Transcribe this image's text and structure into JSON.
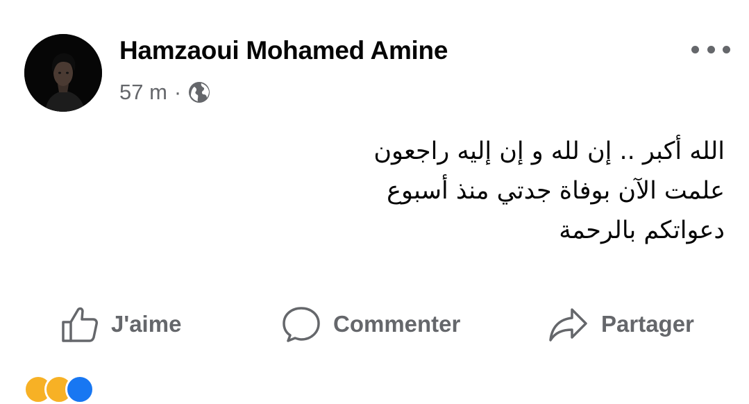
{
  "post": {
    "author": "Hamzaoui Mohamed Amine",
    "time": "57 m",
    "separator": "·",
    "privacy_icon": "globe-icon",
    "more_icon": "more-horizontal-icon",
    "text_lines": [
      "الله أكبر .. إن لله و إن إليه راجعون",
      "علمت الآن بوفاة جدتي منذ أسبوع",
      "دعواتكم بالرحمة"
    ]
  },
  "actions": {
    "like": {
      "label": "J'aime",
      "icon": "thumbs-up-icon"
    },
    "comment": {
      "label": "Commenter",
      "icon": "comment-bubble-icon"
    },
    "share": {
      "label": "Partager",
      "icon": "share-arrow-icon"
    }
  },
  "reactions": [
    {
      "icon": "haha-reaction-icon",
      "color": "#f7b125"
    },
    {
      "icon": "sad-reaction-icon",
      "color": "#f7b125"
    },
    {
      "icon": "like-reaction-icon",
      "color": "#1877f2"
    }
  ],
  "colors": {
    "primary_text": "#050505",
    "secondary_text": "#65676b",
    "background": "#ffffff"
  }
}
